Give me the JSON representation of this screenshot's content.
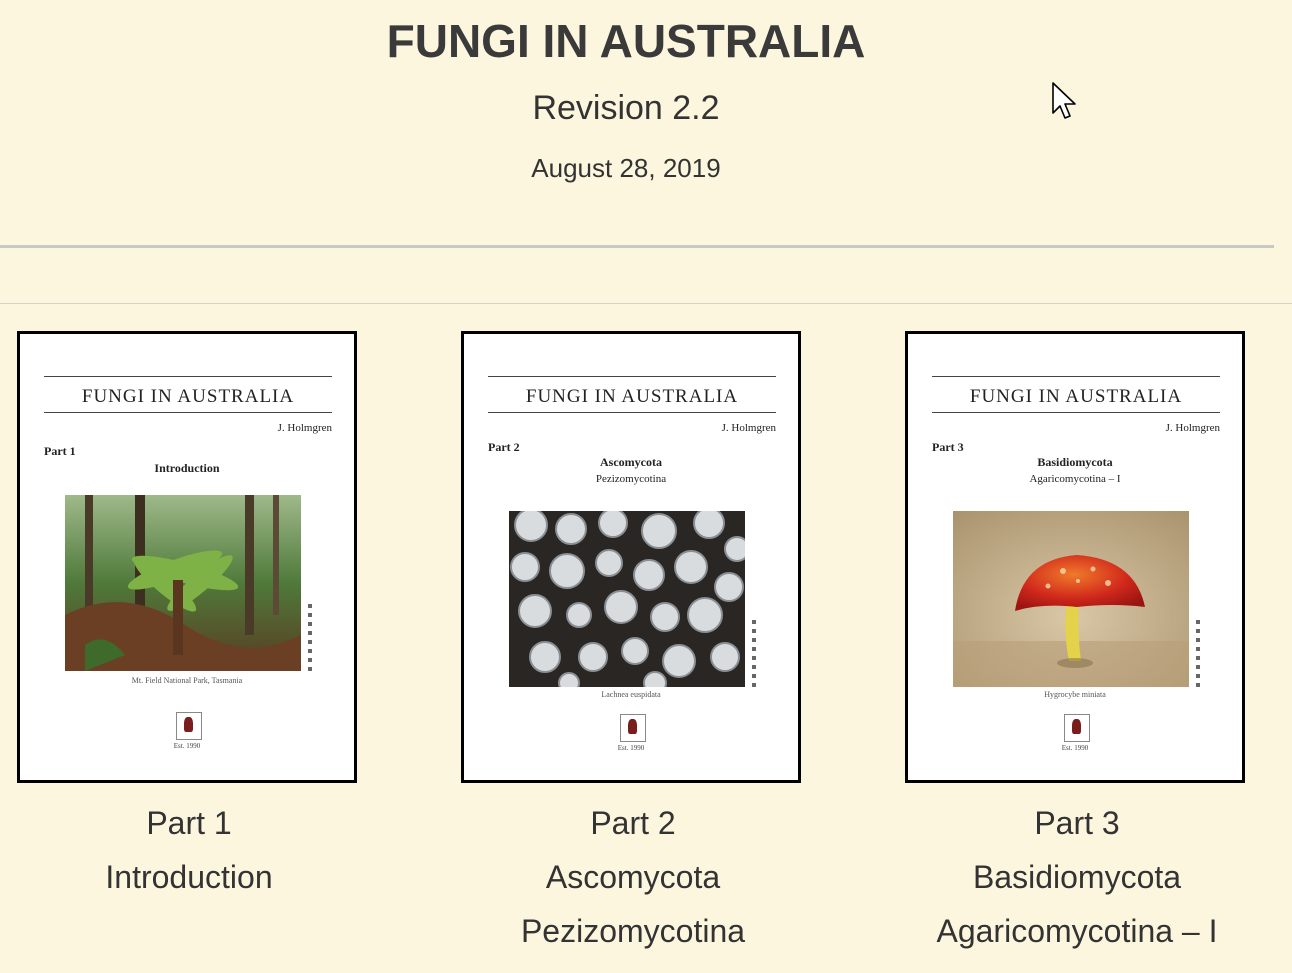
{
  "header": {
    "title": "FUNGI IN AUSTRALIA",
    "revision": "Revision 2.2",
    "date": "August 28, 2019"
  },
  "cards": [
    {
      "cover": {
        "title": "FUNGI IN AUSTRALIA",
        "author": "J. Holmgren",
        "part": "Part 1",
        "name": "Introduction",
        "sub": "",
        "caption": "Mt. Field National Park, Tasmania"
      },
      "caption_lines": [
        "Part 1",
        "Introduction",
        ""
      ]
    },
    {
      "cover": {
        "title": "FUNGI IN AUSTRALIA",
        "author": "J. Holmgren",
        "part": "Part 2",
        "name": "Ascomycota",
        "sub": "Pezizomycotina",
        "caption": "Lachnea euspidata"
      },
      "caption_lines": [
        "Part 2",
        "Ascomycota",
        "Pezizomycotina"
      ]
    },
    {
      "cover": {
        "title": "FUNGI IN AUSTRALIA",
        "author": "J. Holmgren",
        "part": "Part 3",
        "name": "Basidiomycota",
        "sub": "Agaricomycotina – I",
        "caption": "Hygrocybe miniata"
      },
      "caption_lines": [
        "Part 3",
        "Basidiomycota",
        "Agaricomycotina – I"
      ]
    }
  ]
}
